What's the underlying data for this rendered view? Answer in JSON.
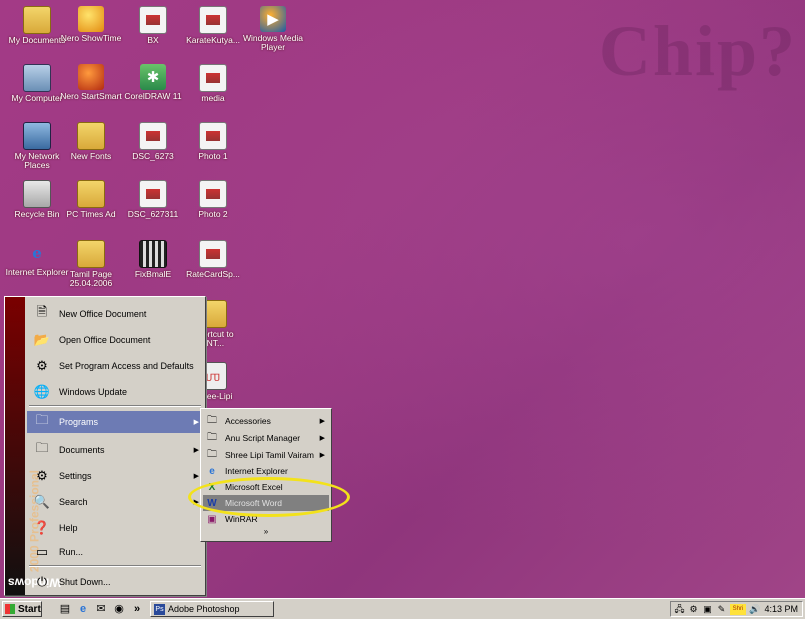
{
  "desktop": {
    "icons": [
      {
        "label": "My Documents",
        "icon": "folder-icon"
      },
      {
        "label": "Nero ShowTime",
        "icon": "nero-showtime-icon"
      },
      {
        "label": "BX",
        "icon": "document-icon"
      },
      {
        "label": "KarateKutya...",
        "icon": "document-icon"
      },
      {
        "label": "Windows Media Player",
        "icon": "media-player-icon"
      },
      {
        "label": "My Computer",
        "icon": "computer-icon"
      },
      {
        "label": "Nero StartSmart",
        "icon": "nero-startsmart-icon"
      },
      {
        "label": "CorelDRAW 11",
        "icon": "coreldraw-icon"
      },
      {
        "label": "media",
        "icon": "document-icon"
      },
      {
        "label": "My Network Places",
        "icon": "network-icon"
      },
      {
        "label": "New Fonts",
        "icon": "folder-icon"
      },
      {
        "label": "DSC_6273",
        "icon": "document-icon"
      },
      {
        "label": "Photo 1",
        "icon": "document-icon"
      },
      {
        "label": "Recycle Bin",
        "icon": "recycle-bin-icon"
      },
      {
        "label": "PC Times Ad",
        "icon": "folder-icon"
      },
      {
        "label": "DSC_627311",
        "icon": "document-icon"
      },
      {
        "label": "Photo 2",
        "icon": "document-icon"
      },
      {
        "label": "Internet Explorer",
        "icon": "internet-explorer-icon"
      },
      {
        "label": "Tamil Page 25.04.2006",
        "icon": "folder-icon"
      },
      {
        "label": "FixBmalE",
        "icon": "film-icon"
      },
      {
        "label": "RateCardSp...",
        "icon": "document-icon"
      },
      {
        "label": "Shortcut to _NT...",
        "icon": "folder-icon"
      },
      {
        "label": "Shree-Lipi",
        "icon": "shree-lipi-icon"
      }
    ],
    "background_text": "Chip?"
  },
  "start_menu": {
    "banner_brand": "Windows",
    "banner_edition": "2000 Professional",
    "items": [
      {
        "label": "New Office Document",
        "icon": "new-office-document-icon"
      },
      {
        "label": "Open Office Document",
        "icon": "open-office-document-icon"
      },
      {
        "label": "Set Program Access and Defaults",
        "icon": "program-access-icon"
      },
      {
        "label": "Windows Update",
        "icon": "windows-update-icon"
      },
      {
        "label": "Programs",
        "icon": "programs-icon"
      },
      {
        "label": "Documents",
        "icon": "documents-icon"
      },
      {
        "label": "Settings",
        "icon": "settings-icon"
      },
      {
        "label": "Search",
        "icon": "search-icon"
      },
      {
        "label": "Help",
        "icon": "help-icon"
      },
      {
        "label": "Run...",
        "icon": "run-icon"
      },
      {
        "label": "Shut Down...",
        "icon": "shut-down-icon"
      }
    ]
  },
  "programs_menu": {
    "items": [
      {
        "label": "Accessories",
        "icon": "folder-icon"
      },
      {
        "label": "Anu Script Manager",
        "icon": "folder-icon"
      },
      {
        "label": "Shree Lipi Tamil Vairam",
        "icon": "folder-icon"
      },
      {
        "label": "Internet Explorer",
        "icon": "internet-explorer-icon"
      },
      {
        "label": "Microsoft Excel",
        "icon": "excel-icon"
      },
      {
        "label": "Microsoft Word",
        "icon": "word-icon"
      },
      {
        "label": "WinRAR",
        "icon": "winrar-icon"
      }
    ],
    "more_chevron": "»"
  },
  "taskbar": {
    "start_label": "Start",
    "quick_launch_more": "»",
    "task_button_label": "Adobe Photoshop",
    "tray_badge": "Shri",
    "clock": "4:13 PM"
  }
}
